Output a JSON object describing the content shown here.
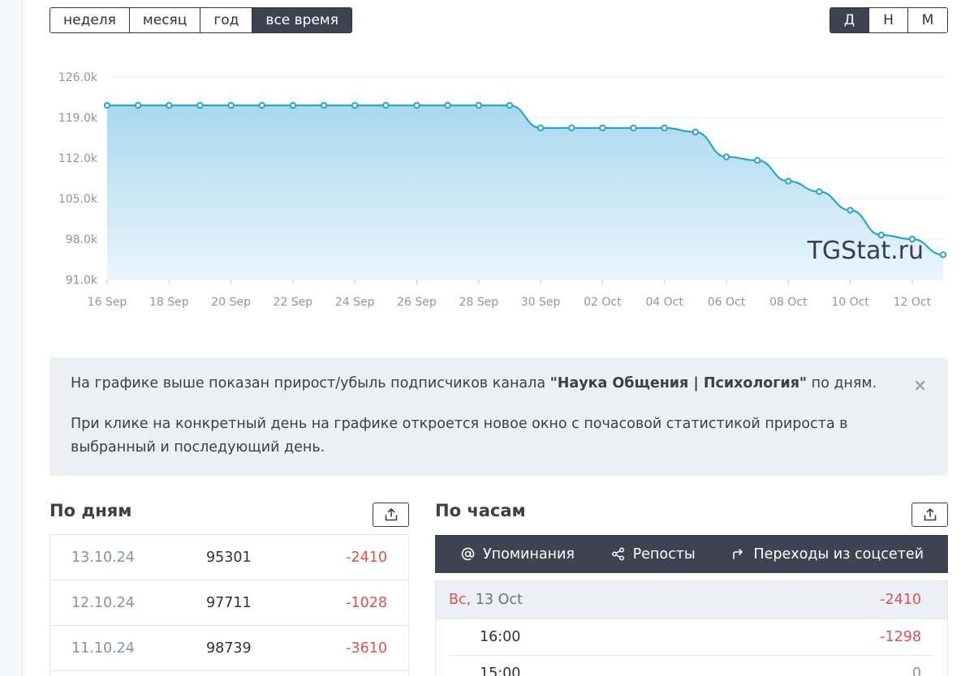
{
  "period_tabs": [
    "неделя",
    "месяц",
    "год",
    "все время"
  ],
  "period_active": 3,
  "gran_tabs": [
    "Д",
    "Н",
    "М"
  ],
  "gran_active": 0,
  "chart_data": {
    "type": "area",
    "watermark": "TGStat.ru",
    "y_ticks": [
      "126.0k",
      "119.0k",
      "112.0k",
      "105.0k",
      "98.0k",
      "91.0k"
    ],
    "ylim": [
      91000,
      126000
    ],
    "x_ticks": [
      "16 Sep",
      "18 Sep",
      "20 Sep",
      "22 Sep",
      "24 Sep",
      "26 Sep",
      "28 Sep",
      "30 Sep",
      "02 Oct",
      "04 Oct",
      "06 Oct",
      "08 Oct",
      "10 Oct",
      "12 Oct"
    ],
    "values": [
      121100,
      121100,
      121100,
      121100,
      121100,
      121100,
      121100,
      121100,
      121100,
      121100,
      121100,
      121100,
      121100,
      121100,
      117200,
      117200,
      117200,
      117200,
      117200,
      116500,
      112200,
      111600,
      108000,
      106200,
      103000,
      98700,
      98000,
      95300
    ],
    "color": "#2ba6cb"
  },
  "info": {
    "line1_before": "На графике выше показан прирост/убыль подписчиков канала ",
    "channel": "\"Наука Общения | Психология\"",
    "line1_after": " по дням.",
    "line2": "При клике на конкретный день на графике откроется новое окно с почасовой статистикой прироста в выбранный и последующий день.",
    "close": "×"
  },
  "by_days": {
    "title": "По дням",
    "rows": [
      {
        "date": "13.10.24",
        "subs": "95301",
        "diff": "-2410"
      },
      {
        "date": "12.10.24",
        "subs": "97711",
        "diff": "-1028"
      },
      {
        "date": "11.10.24",
        "subs": "98739",
        "diff": "-3610"
      }
    ]
  },
  "by_hours": {
    "title": "По часам",
    "tabs": [
      "Упоминания",
      "Репосты",
      "Переходы из соцсетей"
    ],
    "header": {
      "dow": "Вс",
      "date": ", 13 Oct",
      "diff": "-2410"
    },
    "rows": [
      {
        "time": "16:00",
        "diff": "-1298"
      },
      {
        "time": "15:00",
        "diff": "0"
      }
    ]
  }
}
